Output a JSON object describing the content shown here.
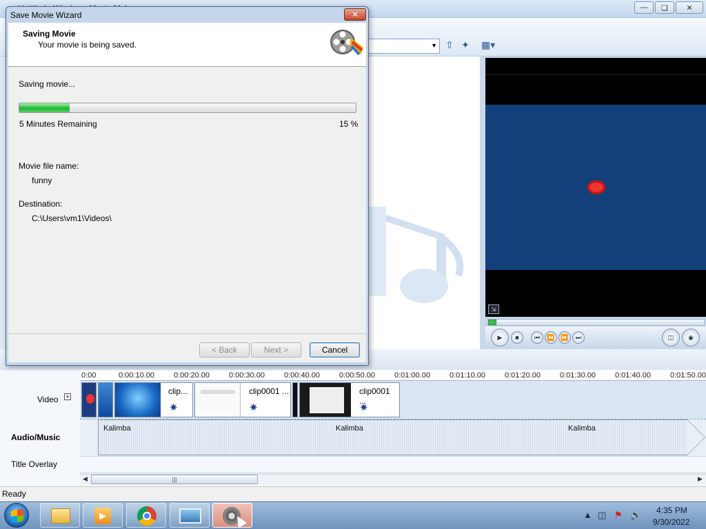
{
  "app": {
    "title": "Untitled - Windows Movie Maker",
    "status": "Ready"
  },
  "dialog": {
    "title": "Save Movie Wizard",
    "heading": "Saving Movie",
    "subheading": "Your movie is being saved.",
    "progress_label": "Saving movie...",
    "progress_percent": 15,
    "progress_text": "15 %",
    "remaining": "5 Minutes Remaining",
    "file_name_label": "Movie file name:",
    "file_name": "funny",
    "destination_label": "Destination:",
    "destination": "C:\\Users\\vm1\\Videos\\",
    "buttons": {
      "back": "< Back",
      "next": "Next >",
      "cancel": "Cancel"
    }
  },
  "timeline": {
    "ruler": [
      "0:00",
      "0:00:10.00",
      "0:00:20.00",
      "0:00:30.00",
      "0:00:40.00",
      "0:00:50.00",
      "0:01:00.00",
      "0:01:10.00",
      "0:01:20.00",
      "0:01:30.00",
      "0:01:40.00",
      "0:01:50.00"
    ],
    "tracks": {
      "video": "Video",
      "audio": "Audio/Music",
      "title": "Title Overlay"
    },
    "clips": [
      "clip...",
      "clip0001 ...",
      "clip0001 ..."
    ],
    "audio_clips": [
      "Kalimba",
      "Kalimba",
      "Kalimba"
    ]
  },
  "taskbar": {
    "time": "4:35 PM",
    "date": "9/30/2022"
  },
  "colors": {
    "progress_fill": "#23b53a",
    "preview_video": "#133f7b",
    "taskbar": "#6f93bd"
  }
}
